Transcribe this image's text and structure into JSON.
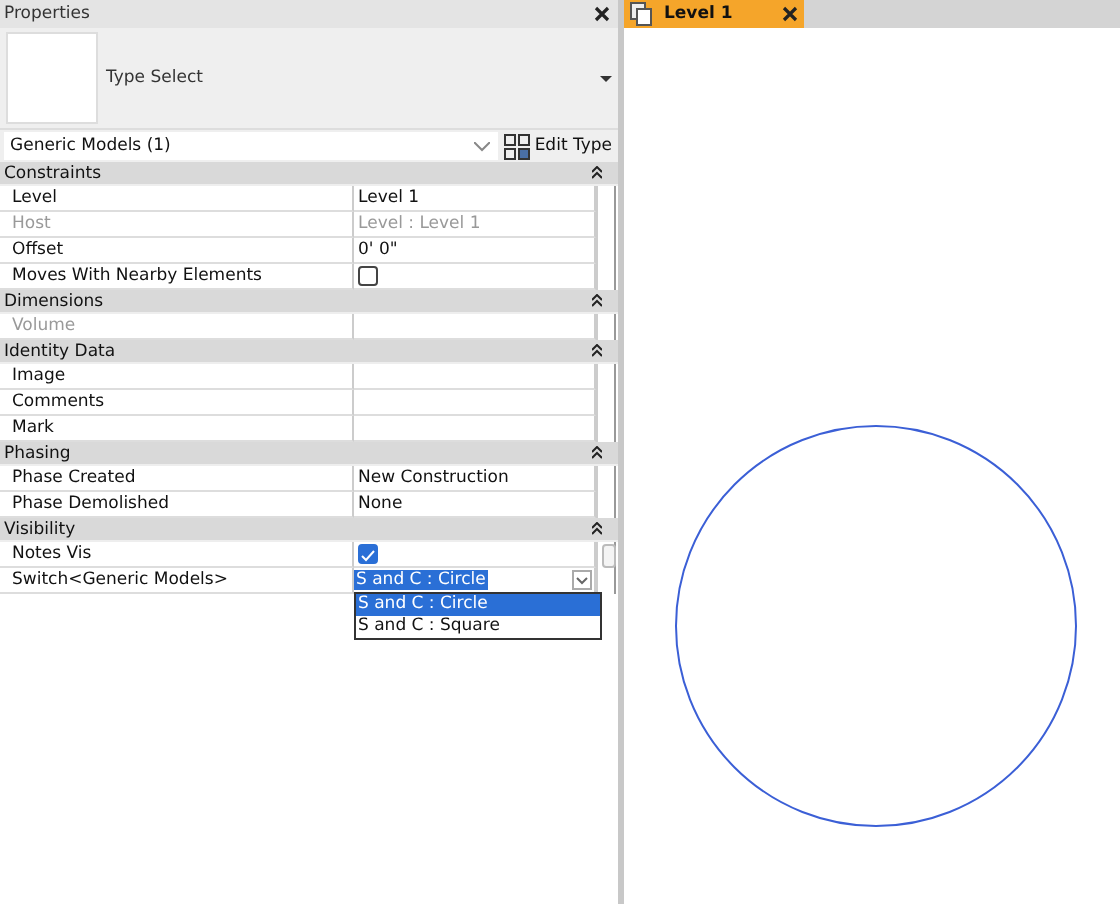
{
  "properties": {
    "title": "Properties",
    "type_select": {
      "label": "Type Select"
    },
    "type_dropdown": {
      "value": "Generic Models (1)"
    },
    "edit_type_button": {
      "label": "Edit Type"
    },
    "sections": [
      {
        "title": "Constraints",
        "expanded": true,
        "rows": [
          {
            "label": "Level",
            "value": "Level 1",
            "kind": "text",
            "disabled": false
          },
          {
            "label": "Host",
            "value": "Level : Level 1",
            "kind": "text",
            "disabled": true
          },
          {
            "label": "Offset",
            "value": "0'  0\"",
            "kind": "text",
            "disabled": false
          },
          {
            "label": "Moves With Nearby Elements",
            "kind": "checkbox",
            "checked": false,
            "disabled": false
          }
        ]
      },
      {
        "title": "Dimensions",
        "expanded": true,
        "rows": [
          {
            "label": "Volume",
            "kind": "text",
            "disabled": true
          }
        ]
      },
      {
        "title": "Identity Data",
        "expanded": true,
        "rows": [
          {
            "label": "Image",
            "kind": "text",
            "disabled": false
          },
          {
            "label": "Comments",
            "kind": "text",
            "disabled": false
          },
          {
            "label": "Mark",
            "kind": "text",
            "disabled": false
          }
        ]
      },
      {
        "title": "Phasing",
        "expanded": true,
        "rows": [
          {
            "label": "Phase Created",
            "value": "New Construction",
            "kind": "text",
            "disabled": false
          },
          {
            "label": "Phase Demolished",
            "value": "None",
            "kind": "text",
            "disabled": false
          }
        ]
      },
      {
        "title": "Visibility",
        "expanded": true,
        "rows": [
          {
            "label": "Notes Vis",
            "kind": "checkbox",
            "checked": true,
            "disabled": false
          },
          {
            "label": "Switch<Generic Models>",
            "value": "S and C : Circle",
            "kind": "dropdown",
            "disabled": false,
            "open": true,
            "options": [
              {
                "label": "S and C : Circle",
                "selected": true
              },
              {
                "label": "S and C : Square",
                "selected": false
              }
            ]
          }
        ]
      }
    ]
  },
  "view": {
    "tabs": [
      {
        "title": "Level 1",
        "selected": true
      }
    ]
  }
}
